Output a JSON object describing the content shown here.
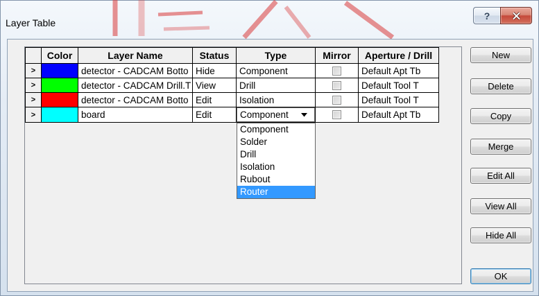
{
  "window": {
    "title": "Layer Table",
    "help_label": "?"
  },
  "icons": {
    "close": "close-icon",
    "dropdown": "chevron-down-icon",
    "mirror_checkbox": "checkbox-icon"
  },
  "colors": {
    "selection": "#3399ff"
  },
  "table": {
    "columns": [
      "Color",
      "Layer Name",
      "Status",
      "Type",
      "Mirror",
      "Aperture / Drill"
    ],
    "row_marker": ">",
    "rows": [
      {
        "color": "#0000ff",
        "layer_name": "detector - CADCAM Botto",
        "status": "Hide",
        "type": "Component",
        "mirror": false,
        "aperture": "Default Apt Tb"
      },
      {
        "color": "#00ff00",
        "layer_name": "detector - CADCAM Drill.T",
        "status": "View",
        "type": "Drill",
        "mirror": false,
        "aperture": "Default Tool T"
      },
      {
        "color": "#ff0000",
        "layer_name": "detector - CADCAM Botto",
        "status": "Edit",
        "type": "Isolation",
        "mirror": false,
        "aperture": "Default Tool T"
      },
      {
        "color": "#00ffff",
        "layer_name": "board",
        "status": "Edit",
        "type": "Component",
        "mirror": false,
        "aperture": "Default Apt Tb"
      }
    ]
  },
  "type_dropdown": {
    "options": [
      "Component",
      "Solder",
      "Drill",
      "Isolation",
      "Rubout",
      "Router"
    ],
    "highlighted_index": 5
  },
  "buttons": {
    "new": "New",
    "delete": "Delete",
    "copy": "Copy",
    "merge": "Merge",
    "edit_all": "Edit All",
    "view_all": "View All",
    "hide_all": "Hide All",
    "ok": "OK"
  }
}
